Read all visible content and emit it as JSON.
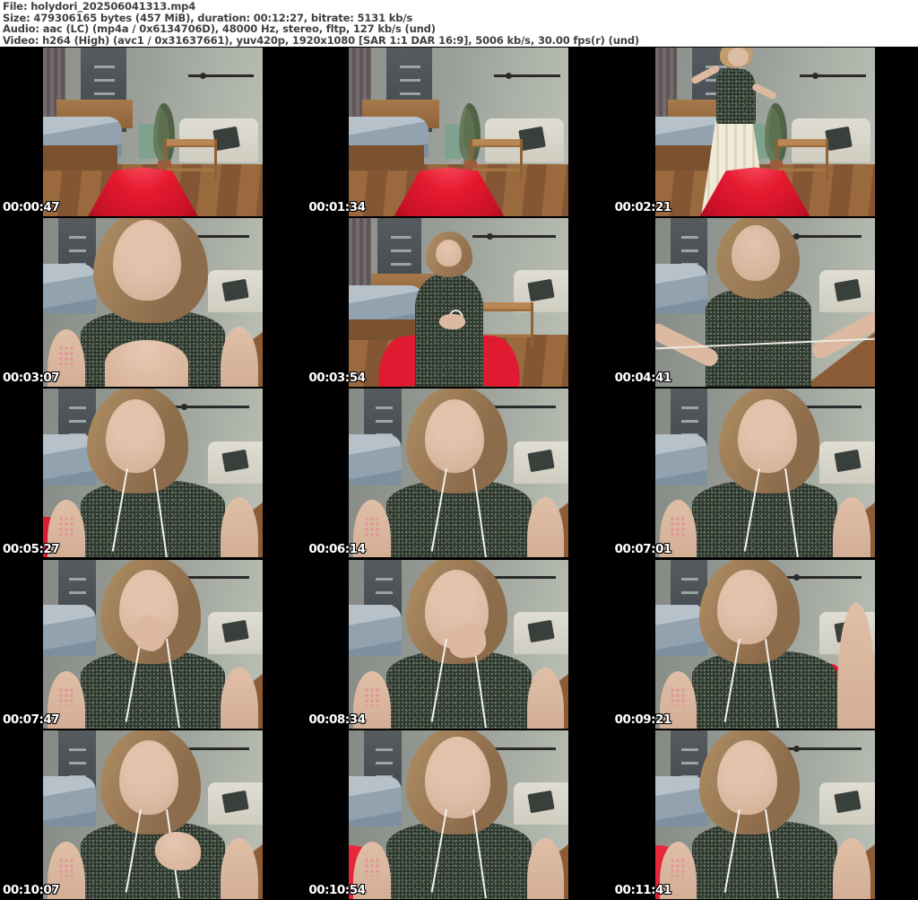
{
  "header": {
    "file_line": "File: holydori_202506041313.mp4",
    "size_line": "Size: 479306165 bytes (457 MiB), duration: 00:12:27, bitrate: 5131 kb/s",
    "audio_line": "Audio: aac (LC) (mp4a / 0x6134706D), 48000 Hz, stereo, fltp, 127 kb/s (und)",
    "video_line": "Video: h264 (High) (avc1 / 0x31637661), yuv420p, 1920x1080 [SAR 1:1 DAR 16:9], 5006 kb/s, 30.00 fps(r) (und)"
  },
  "grid": {
    "columns": 3,
    "rows": 5
  },
  "thumbnails": [
    {
      "time": "00:00:47",
      "scene": "room-empty",
      "description": "empty room with bed, couch, plant and red chair back"
    },
    {
      "time": "00:01:34",
      "scene": "room-empty",
      "description": "empty room with bed, couch, plant and red chair back"
    },
    {
      "time": "00:02:21",
      "scene": "room-standing",
      "description": "woman standing in dark green top and long cream skirt"
    },
    {
      "time": "00:03:07",
      "scene": "face-pointing",
      "description": "close-up face leaning forward pointing at camera"
    },
    {
      "time": "00:03:54",
      "scene": "sitting-string",
      "description": "woman seated on red chair holding a white string"
    },
    {
      "time": "00:04:41",
      "scene": "string-stretch",
      "description": "woman stretching a white string between both hands"
    },
    {
      "time": "00:05:27",
      "scene": "face-left",
      "description": "close-up face with earphones, red chair corner lower left"
    },
    {
      "time": "00:06:14",
      "scene": "face-center",
      "description": "close-up face looking down with earphones"
    },
    {
      "time": "00:07:01",
      "scene": "face-right",
      "description": "close-up face neutral expression with earphones"
    },
    {
      "time": "00:07:47",
      "scene": "face-hand-mouth",
      "description": "close-up face with hand near mouth"
    },
    {
      "time": "00:08:34",
      "scene": "face-hand-chin",
      "description": "close-up face with hand at chin"
    },
    {
      "time": "00:09:21",
      "scene": "face-arm-right",
      "description": "close-up face with raised arm at right edge"
    },
    {
      "time": "00:10:07",
      "scene": "face-hand-raised",
      "description": "close-up face gesturing with raised hand"
    },
    {
      "time": "00:10:54",
      "scene": "face-chair",
      "description": "very close face with red chair wedge lower left"
    },
    {
      "time": "00:11:41",
      "scene": "face-chair-left",
      "description": "close-up face talking, red chair wedge lower left"
    }
  ],
  "colors": {
    "header_background": "#ffffff",
    "header_text": "#3f3f3f",
    "sheet_background": "#000000",
    "timestamp_text": "#ffffff",
    "chair_red": "#e61a31"
  }
}
